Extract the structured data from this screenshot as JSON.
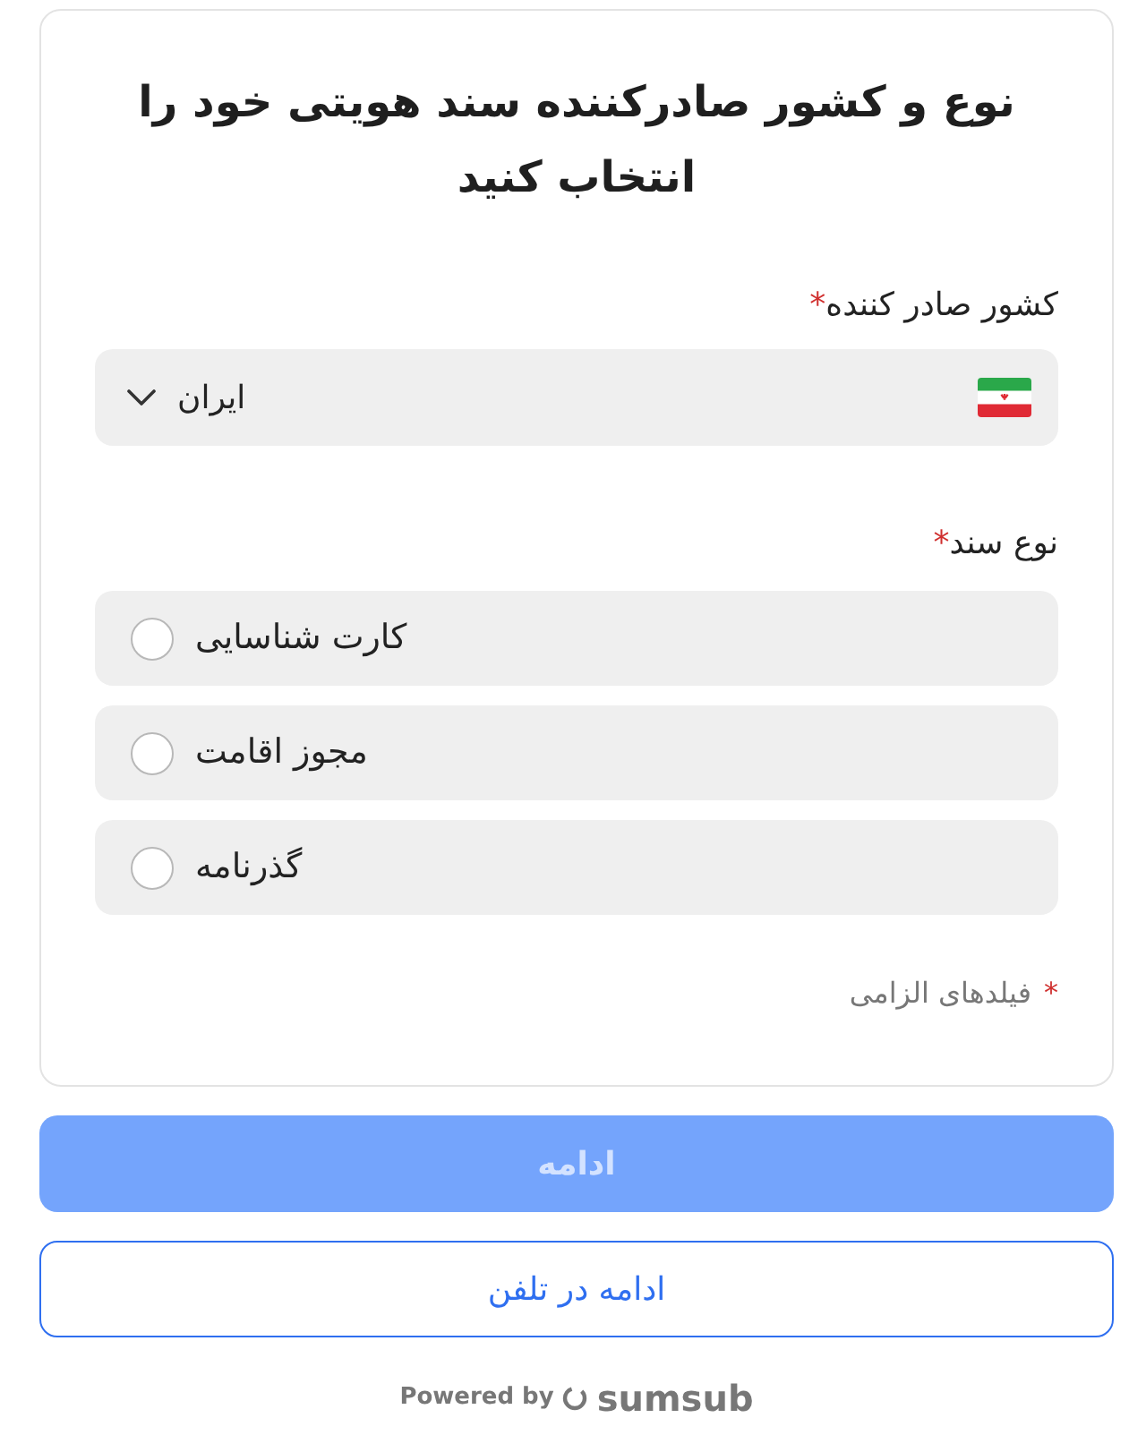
{
  "title": "نوع و کشور صادرکننده سند هویتی خود را انتخاب کنید",
  "country_field": {
    "label": "کشور صادر کننده",
    "required_mark": "*",
    "value": "ایران"
  },
  "document_type": {
    "label": "نوع سند",
    "required_mark": "*",
    "options": [
      {
        "label": "کارت شناسایی",
        "selected": false
      },
      {
        "label": "مجوز اقامت",
        "selected": false
      },
      {
        "label": "گذرنامه",
        "selected": false
      }
    ]
  },
  "required_note": {
    "mark": "*",
    "text": "فیلدهای الزامی"
  },
  "buttons": [
    {
      "label": "ادامه",
      "kind": "primary",
      "disabled": true
    },
    {
      "label": "ادامه در تلفن",
      "kind": "outline",
      "disabled": false
    }
  ],
  "footer": {
    "powered_by": "Powered by",
    "brand": "sumsub"
  }
}
